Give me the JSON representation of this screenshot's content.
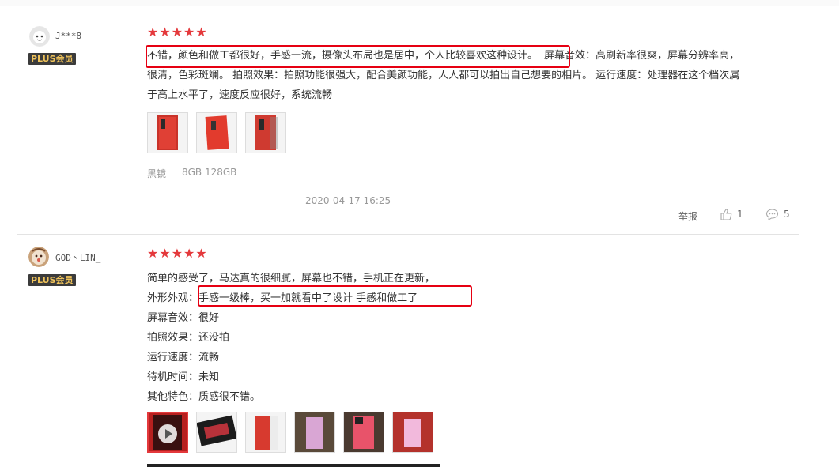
{
  "review1": {
    "username": "J***8",
    "badge": "PLUS会员",
    "text_line1_highlight": "不错，颜色和做工都很好，手感一流，摄像头布局也是居中，个人比较喜欢这种设计。",
    "text_line1_rest": "屏幕音效：高刷新率很爽，屏幕分辨率高，",
    "text_line2": "很清，色彩斑斓。 拍照效果：拍照功能很强大，配合美颜功能，人人都可以拍出自己想要的相片。 运行速度：处理器在这个档次属",
    "text_line3": "于高上水平了，速度反应很好，系统流畅",
    "spec_color": "黑镜",
    "spec_memory": "8GB 128GB",
    "date": "2020-04-17 16:25",
    "report_label": "举报",
    "like_count": "1",
    "comment_count": "5"
  },
  "review2": {
    "username": "GOD丶LIN_",
    "badge": "PLUS会员",
    "line1": "简单的感受了，马达真的很细腻，屏幕也不错，手机正在更新，",
    "line2_label": "外形外观：",
    "line2_value": "手感一级棒，买一加就看中了设计 手感和做工了",
    "line3": "屏幕音效：很好",
    "line4": "拍照效果：还没拍",
    "line5": "运行速度：流畅",
    "line6": "待机时间：未知",
    "line7": "其他特色：质感很不错。"
  },
  "icons": {
    "star": "star-icon",
    "like": "thumbs-up-icon",
    "comment": "comment-icon",
    "play": "play-icon"
  },
  "colors": {
    "star": "#e4393c",
    "highlight_box": "#e60012",
    "badge_bg": "#3b3b3b",
    "badge_text": "#f0c35a"
  }
}
